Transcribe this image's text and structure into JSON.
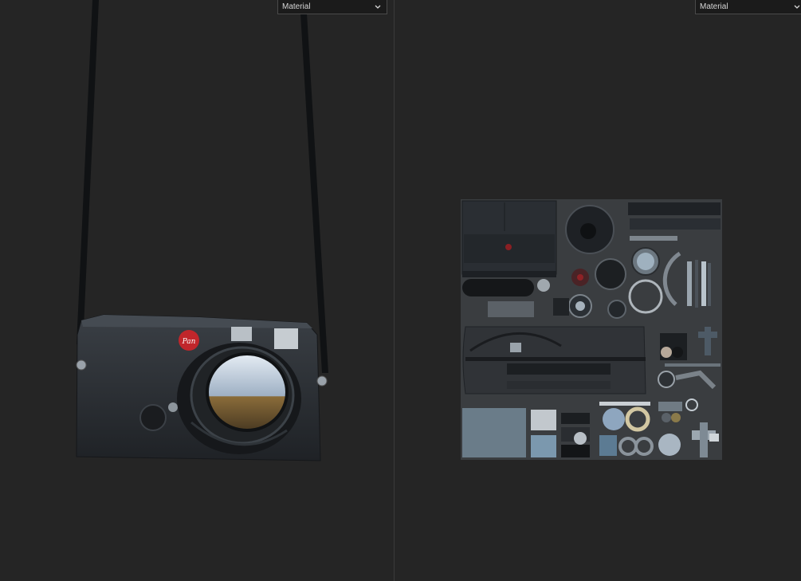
{
  "viewports": {
    "left": {
      "mode_dropdown": {
        "selected": "Material",
        "icon": "chevron-down-icon"
      },
      "scene": "3d-camera-model",
      "badge_text": "Pan"
    },
    "right": {
      "mode_dropdown": {
        "selected": "Material",
        "icon": "chevron-down-icon"
      },
      "scene": "uv-texture-atlas"
    }
  },
  "colors": {
    "background": "#252525",
    "camera_body": "#2b2f33",
    "badge_red": "#c0262b",
    "atlas_bg": "#3a3d40"
  }
}
